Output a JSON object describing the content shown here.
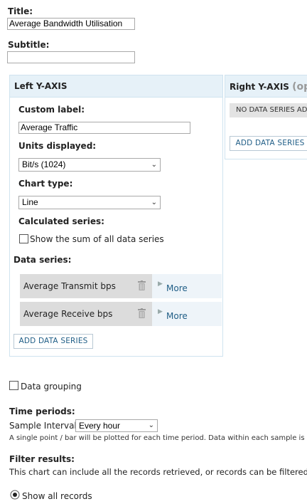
{
  "title": {
    "label": "Title:",
    "value": "Average Bandwidth Utilisation"
  },
  "subtitle": {
    "label": "Subtitle:",
    "value": ""
  },
  "left_axis": {
    "heading": "Left Y-AXIS",
    "custom_label": {
      "label": "Custom label:",
      "value": "Average Traffic"
    },
    "units": {
      "label": "Units displayed:",
      "value": "Bit/s (1024)"
    },
    "chart_type": {
      "label": "Chart type:",
      "value": "Line"
    },
    "calculated": {
      "label": "Calculated series:",
      "checkbox_label": "Show the sum of all data series"
    },
    "data_series_label": "Data series:",
    "series": [
      {
        "name": "Average Transmit bps",
        "more": "More"
      },
      {
        "name": "Average Receive bps",
        "more": "More"
      }
    ],
    "add_button": "ADD DATA SERIES"
  },
  "right_axis": {
    "heading": "Right Y-AXIS",
    "heading_suffix": "(opt",
    "empty_text": "NO DATA SERIES ADD",
    "add_button": "ADD DATA SERIES"
  },
  "data_grouping": {
    "label": "Data grouping"
  },
  "time_periods": {
    "heading": "Time periods:",
    "sample_label": "Sample Interval:",
    "sample_value": "Every hour",
    "note": "A single point / bar will be plotted for each time period. Data within each sample is aut"
  },
  "filter": {
    "heading": "Filter results:",
    "description": "This chart can include all the records retrieved, or records can be filtered.",
    "option_all": "Show all records"
  },
  "colors": {
    "panel_header": "#e6f1f8",
    "panel_border": "#cfe3ef",
    "link": "#1f5d86",
    "series_bg": "#dcdcdc"
  }
}
